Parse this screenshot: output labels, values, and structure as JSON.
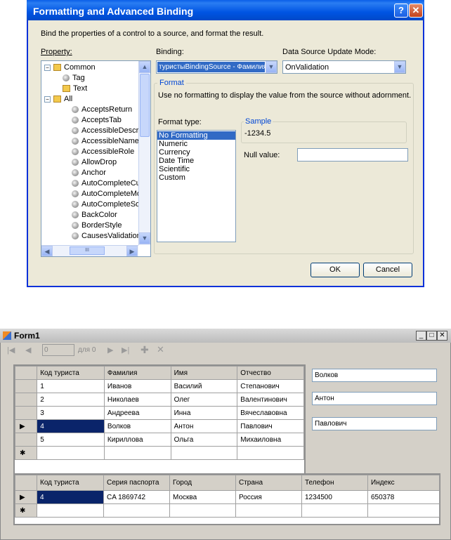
{
  "dialog": {
    "title": "Formatting and Advanced Binding",
    "help": "?",
    "close": "✕",
    "description": "Bind the properties of a control to a source, and format the result.",
    "property_label": "Property:",
    "binding_label": "Binding:",
    "binding_value": "туристыBindingSource - Фамилия",
    "update_mode_label": "Data Source Update Mode:",
    "update_mode_value": "OnValidation",
    "format_group_label": "Format",
    "format_description": "Use no formatting to display the value from the source without adornment.",
    "format_type_label": "Format type:",
    "format_types": [
      "No Formatting",
      "Numeric",
      "Currency",
      "Date Time",
      "Scientific",
      "Custom"
    ],
    "selected_format": "No Formatting",
    "sample_label": "Sample",
    "sample_value": "-1234.5",
    "null_value_label": "Null value:",
    "null_value": "",
    "ok": "OK",
    "cancel": "Cancel",
    "tree": {
      "common": "Common",
      "common_children": [
        "Tag",
        "Text"
      ],
      "all": "All",
      "all_children": [
        "AcceptsReturn",
        "AcceptsTab",
        "AccessibleDescrip",
        "AccessibleName",
        "AccessibleRole",
        "AllowDrop",
        "Anchor",
        "AutoCompleteCus",
        "AutoCompleteMo",
        "AutoCompleteSou",
        "BackColor",
        "BorderStyle",
        "CausesValidation"
      ],
      "scroll_mid": "III"
    }
  },
  "form1": {
    "title": "Form1",
    "min": "_",
    "max": "□",
    "close": "✕",
    "navigator": {
      "position": "0",
      "of_label": "для 0"
    },
    "grid1": {
      "headers": [
        "Код туриста",
        "Фамилия",
        "Имя",
        "Отчество"
      ],
      "rows": [
        [
          "1",
          "Иванов",
          "Василий",
          "Степанович"
        ],
        [
          "2",
          "Николаев",
          "Олег",
          "Валентинович"
        ],
        [
          "3",
          "Андреева",
          "Инна",
          "Вячеславовна"
        ],
        [
          "4",
          "Волков",
          "Антон",
          "Павлович"
        ],
        [
          "5",
          "Кириллова",
          "Ольга",
          "Михаиловна"
        ]
      ],
      "current_row": 3
    },
    "textboxes": [
      "Волков",
      "Антон",
      "Павлович"
    ],
    "grid2": {
      "headers": [
        "Код туриста",
        "Серия паспорта",
        "Город",
        "Страна",
        "Телефон",
        "Индекс"
      ],
      "rows": [
        [
          "4",
          "CA 1869742",
          "Москва",
          "Россия",
          "1234500",
          "650378"
        ]
      ]
    },
    "row_marker": "▶",
    "new_row_marker": "✱"
  }
}
